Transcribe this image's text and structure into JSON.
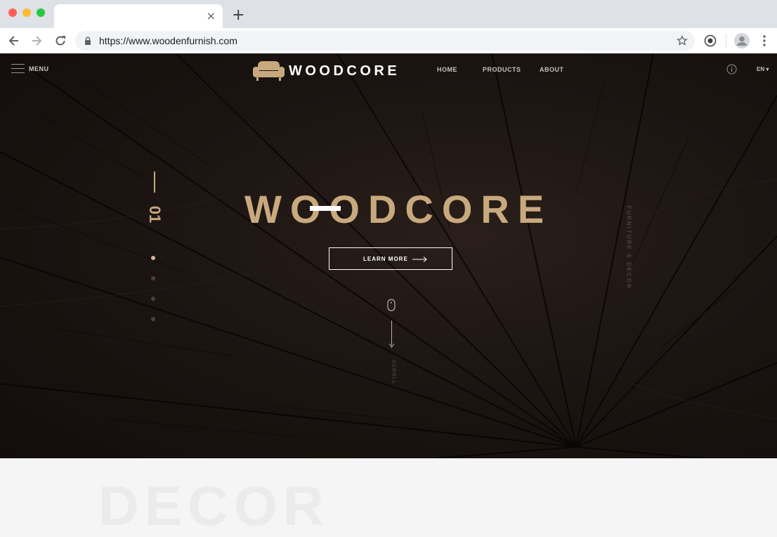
{
  "browser": {
    "url": "https://www.woodenfurnish.com",
    "tab_close": "×",
    "new_tab": "+"
  },
  "site": {
    "menu_label": "MENU",
    "logo_text": "WOODCORE",
    "nav": [
      "HOME",
      "PRODUCTS",
      "ABOUT"
    ],
    "lang": "EN ▾",
    "slide_number": "01",
    "hero_title": "WOODCORE",
    "side_caption": "FURNITURE & DECOR",
    "cta_label": "LEARN MORE",
    "scroll_label": "SCROLL",
    "section_ghost": "DECOR"
  },
  "colors": {
    "accent": "#c8a97e",
    "hero_bg": "#1c1512"
  },
  "icons": [
    "back-icon",
    "forward-icon",
    "reload-icon",
    "lock-icon",
    "star-icon",
    "extension-icon",
    "profile-icon",
    "kebab-icon",
    "hamburger-icon",
    "sofa-logo-icon",
    "info-icon",
    "arrow-right-icon",
    "mouse-icon"
  ]
}
